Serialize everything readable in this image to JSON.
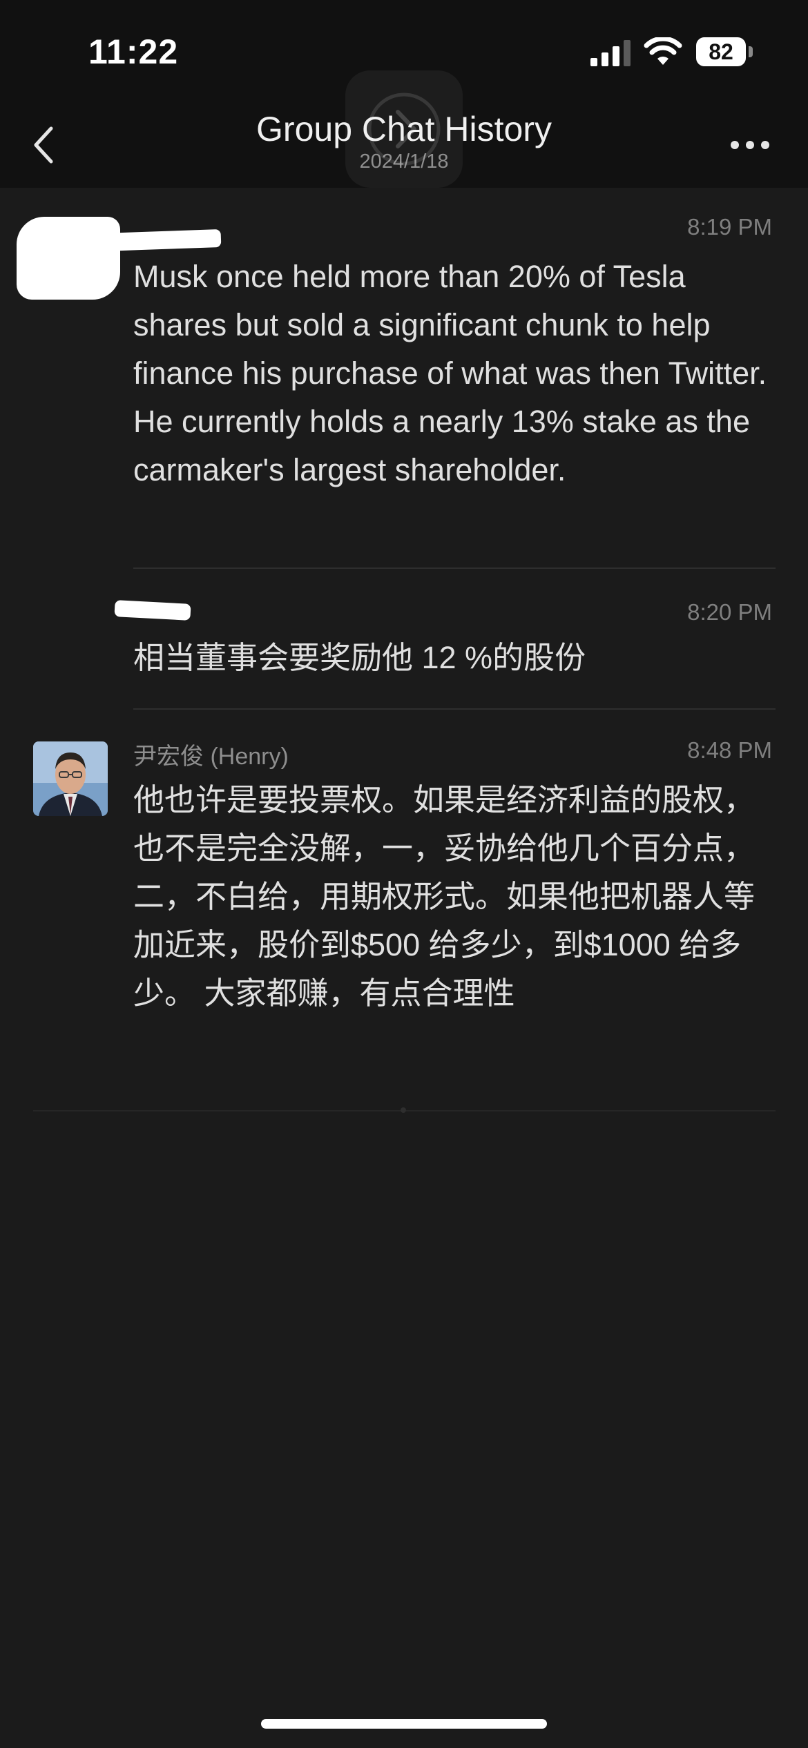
{
  "status_bar": {
    "time": "11:22",
    "battery_level": "82",
    "icons": [
      "signal-icon",
      "wifi-icon",
      "battery-icon"
    ]
  },
  "nav": {
    "title": "Group Chat History",
    "subtitle": "2024/1/18",
    "icons": [
      "chevron-left-icon",
      "more-icon",
      "forward-icon"
    ]
  },
  "messages": [
    {
      "sender": "",
      "time": "8:19 PM",
      "text": "Musk once held more than 20% of Tesla shares but sold a significant chunk to help finance his purchase of what was then Twitter. He currently holds a nearly 13% stake as the carmaker's largest shareholder."
    },
    {
      "sender": "",
      "time": "8:20 PM",
      "text": "相当董事会要奖励他 12 %的股份"
    },
    {
      "sender": "尹宏俊 (Henry)",
      "time": "8:48 PM",
      "text": "他也许是要投票权。如果是经济利益的股权，也不是完全没解，一，妥协给他几个百分点，二，不白给，用期权形式。如果他把机器人等加近来，股价到$500 给多少，到$1000 给多少。 大家都赚，有点合理性"
    }
  ],
  "colors": {
    "background": "#1b1b1b",
    "bar_background": "#111111",
    "text_primary": "#e0e0e0",
    "text_secondary": "#8e8e8e"
  }
}
